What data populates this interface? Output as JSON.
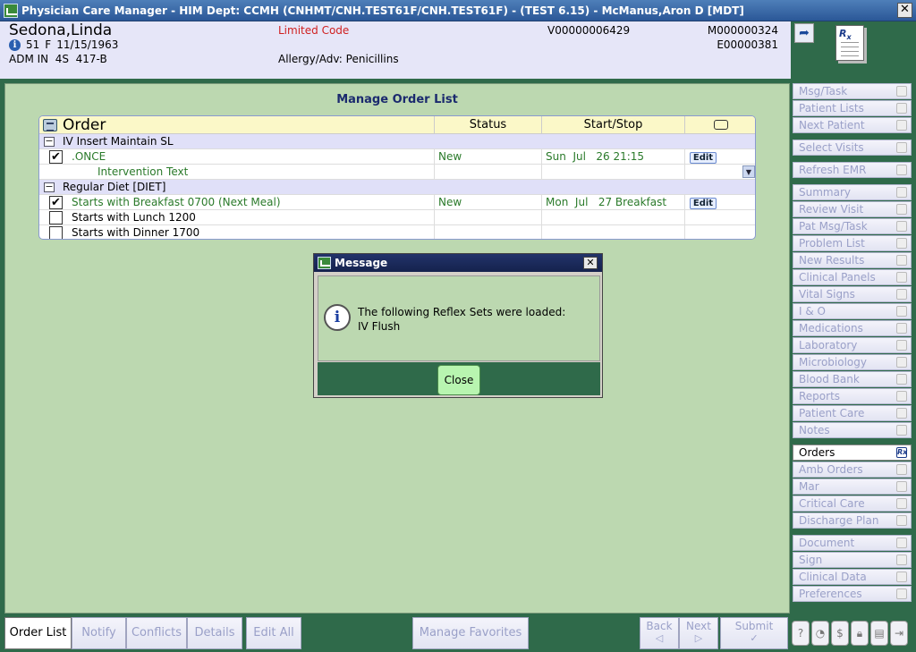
{
  "window": {
    "title": "Physician Care Manager - HIM Dept: CCMH (CNHMT/CNH.TEST61F/CNH.TEST61F) - (TEST 6.15) - McManus,Aron D [MDT]",
    "close": "✕"
  },
  "patient": {
    "name": "Sedona,Linda",
    "age": "51",
    "sex": "F",
    "dob": "11/15/1963",
    "location": "ADM IN  4S  417-B",
    "limited_code": "Limited Code",
    "allergy": "Allergy/Adv: Penicillins",
    "visit_id": "V00000006429",
    "mrn": "M000000324",
    "enc": "E00000381"
  },
  "main": {
    "title": "Manage Order List",
    "columns": {
      "order": "Order",
      "status": "Status",
      "startstop": "Start/Stop"
    },
    "groups": [
      {
        "label": "IV Insert Maintain SL",
        "rows": [
          {
            "checked": true,
            "text": ".ONCE",
            "status": "New",
            "start": "Sun  Jul   26 21:15",
            "edit": "Edit"
          },
          {
            "text": "Intervention Text"
          }
        ]
      },
      {
        "label": "Regular Diet [DIET]",
        "rows": [
          {
            "checked": true,
            "text": "Starts with Breakfast 0700 (Next Meal)",
            "status": "New",
            "start": "Mon  Jul   27 Breakfast",
            "edit": "Edit"
          },
          {
            "checked": false,
            "text": "Starts with Lunch 1200"
          },
          {
            "checked": false,
            "text": "Starts with Dinner 1700"
          }
        ]
      }
    ]
  },
  "dialog": {
    "title": "Message",
    "line1": "The following Reflex Sets were loaded:",
    "line2": "IV Flush",
    "close_label": "Close"
  },
  "sidebar": [
    {
      "label": "Msg/Task"
    },
    {
      "label": "Patient Lists"
    },
    {
      "label": "Next Patient"
    },
    {
      "label": "Select Visits"
    },
    {
      "label": "Refresh EMR"
    },
    {
      "label": "Summary"
    },
    {
      "label": "Review Visit"
    },
    {
      "label": "Pat Msg/Task"
    },
    {
      "label": "Problem List"
    },
    {
      "label": "New Results"
    },
    {
      "label": "Clinical Panels"
    },
    {
      "label": "Vital Signs"
    },
    {
      "label": "I & O"
    },
    {
      "label": "Medications"
    },
    {
      "label": "Laboratory"
    },
    {
      "label": "Microbiology"
    },
    {
      "label": "Blood Bank"
    },
    {
      "label": "Reports"
    },
    {
      "label": "Patient Care"
    },
    {
      "label": "Notes"
    },
    {
      "label": "Orders"
    },
    {
      "label": "Amb Orders"
    },
    {
      "label": "Mar"
    },
    {
      "label": "Critical Care"
    },
    {
      "label": "Discharge Plan"
    },
    {
      "label": "Document"
    },
    {
      "label": "Sign"
    },
    {
      "label": "Clinical Data"
    },
    {
      "label": "Preferences"
    }
  ],
  "bottom": {
    "order_list": "Order List",
    "notify": "Notify",
    "conflicts": "Conflicts",
    "details": "Details",
    "edit_all": "Edit All",
    "manage_favorites": "Manage Favorites",
    "back": "Back",
    "next": "Next",
    "submit": "Submit"
  }
}
